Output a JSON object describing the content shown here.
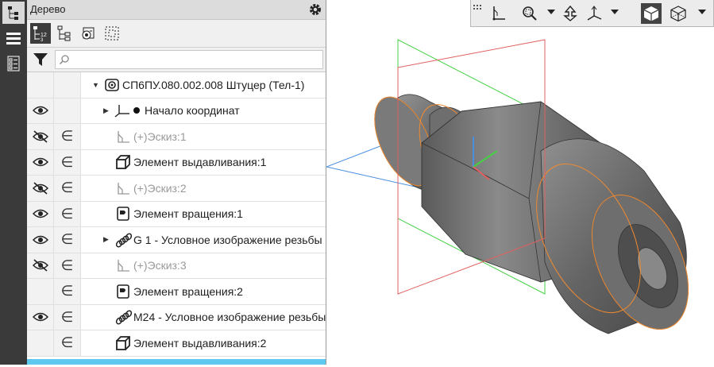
{
  "panel": {
    "title": "Дерево"
  },
  "tree": [
    {
      "label": "СП6ПУ.080.002.008 Штуцер (Тел-1)",
      "eye": "",
      "incl": "",
      "expand": "▼",
      "indent": 0,
      "icon": "part-icon",
      "dim": false
    },
    {
      "label": "Начало координат",
      "eye": "visible",
      "incl": "",
      "expand": "▶",
      "indent": 1,
      "icon": "origin-icon",
      "dim": false
    },
    {
      "label": "Эскиз:1",
      "eye": "hidden",
      "incl": "∈",
      "expand": "",
      "indent": 1,
      "icon": "sketch-icon",
      "dim": true
    },
    {
      "label": "Элемент выдавливания:1",
      "eye": "visible",
      "incl": "∈",
      "expand": "",
      "indent": 1,
      "icon": "extrude-icon",
      "dim": false
    },
    {
      "label": "Эскиз:2",
      "eye": "hidden",
      "incl": "∈",
      "expand": "",
      "indent": 1,
      "icon": "sketch-icon",
      "dim": true
    },
    {
      "label": "Элемент вращения:1",
      "eye": "visible",
      "incl": "∈",
      "expand": "",
      "indent": 1,
      "icon": "revolve-icon",
      "dim": false
    },
    {
      "label": "G 1 - Условное изображение резьбы",
      "eye": "visible",
      "incl": "∈",
      "expand": "▶",
      "indent": 1,
      "icon": "thread-icon",
      "dim": false
    },
    {
      "label": "Эскиз:3",
      "eye": "hidden",
      "incl": "∈",
      "expand": "",
      "indent": 1,
      "icon": "sketch-icon",
      "dim": true
    },
    {
      "label": "Элемент вращения:2",
      "eye": "",
      "incl": "∈",
      "expand": "",
      "indent": 1,
      "icon": "revolve-icon",
      "dim": false
    },
    {
      "label": "M24 - Условное изображение резьбы",
      "eye": "visible",
      "incl": "∈",
      "expand": "",
      "indent": 1,
      "icon": "thread-icon",
      "dim": false
    },
    {
      "label": "Элемент выдавливания:2",
      "eye": "",
      "incl": "∈",
      "expand": "",
      "indent": 1,
      "icon": "extrude-icon",
      "dim": false
    }
  ],
  "sketch_prefix": "(+)",
  "colors": {
    "panel_bg": "#ffffff",
    "accent": "#5ec8ee",
    "toolbar_dark": "#3a3a3a",
    "plane_green": "#46d046",
    "plane_red": "#e06060",
    "plane_blue": "#4a8ee0",
    "edge_orange": "#f08a30"
  }
}
